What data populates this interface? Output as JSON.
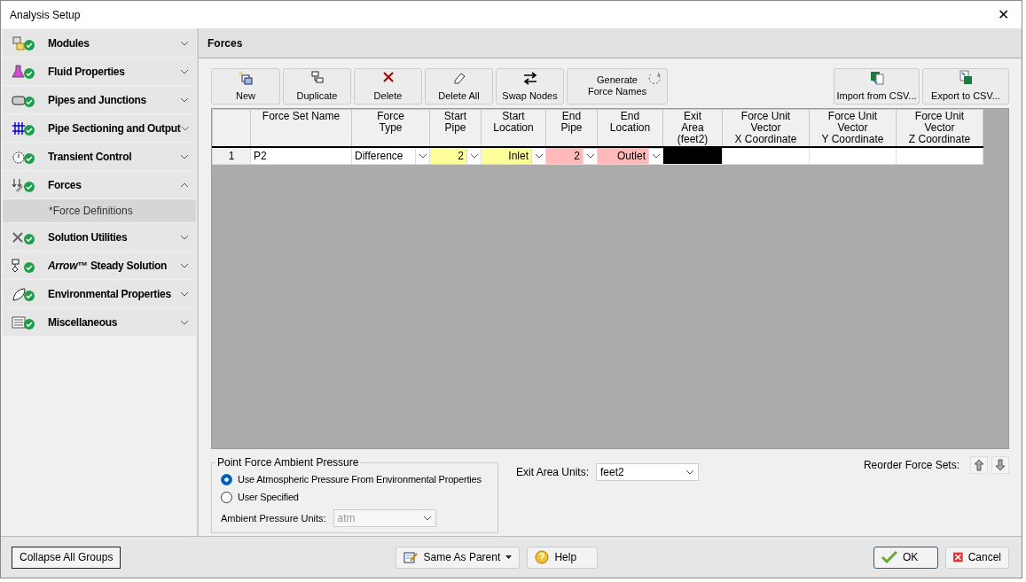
{
  "window": {
    "title": "Analysis Setup",
    "close": "✕"
  },
  "sidebar": {
    "items": [
      {
        "label": "Modules",
        "expanded": false
      },
      {
        "label": "Fluid Properties",
        "expanded": false
      },
      {
        "label": "Pipes and Junctions",
        "expanded": false
      },
      {
        "label": "Pipe Sectioning and Output",
        "expanded": false
      },
      {
        "label": "Transient Control",
        "expanded": false
      },
      {
        "label": "Forces",
        "expanded": true,
        "children": [
          {
            "label": "*Force Definitions",
            "selected": true
          }
        ]
      },
      {
        "label": "Solution Utilities",
        "expanded": false
      },
      {
        "label": "*Arrow*™ Steady Solution",
        "expanded": false
      },
      {
        "label": "Environmental Properties",
        "expanded": false
      },
      {
        "label": "Miscellaneous",
        "expanded": false
      }
    ]
  },
  "panel": {
    "title": "Forces"
  },
  "toolbar": [
    {
      "label": "New"
    },
    {
      "label": "Duplicate"
    },
    {
      "label": "Delete"
    },
    {
      "label": "Delete All"
    },
    {
      "label": "Swap Nodes"
    },
    {
      "label": "Generate\nForce Names"
    }
  ],
  "toolbar_right": [
    {
      "label": "Import from CSV..."
    },
    {
      "label": "Export to CSV..."
    }
  ],
  "table": {
    "columns": [
      "Force Set Name",
      "Force\nType",
      "Start\nPipe",
      "Start\nLocation",
      "End\nPipe",
      "End\nLocation",
      "Exit\nArea\n(feet2)",
      "Force Unit\nVector\nX Coordinate",
      "Force Unit\nVector\nY Coordinate",
      "Force Unit\nVector\nZ Coordinate"
    ],
    "rows": [
      {
        "number": "1",
        "cells": [
          {
            "text": "P2",
            "color": "#ffffff",
            "dropdown": false
          },
          {
            "text": "Difference",
            "color": "#ffffff",
            "dropdown": true
          },
          {
            "text": "2",
            "color": "#ffff99",
            "dropdown": true
          },
          {
            "text": "Inlet",
            "color": "#ffff99",
            "dropdown": true
          },
          {
            "text": "2",
            "color": "#ffb9b9",
            "dropdown": true
          },
          {
            "text": "Outlet",
            "color": "#ffb9b9",
            "dropdown": true
          },
          {
            "text": "",
            "color": "#000000",
            "dropdown": false
          },
          {
            "text": "",
            "color": "#ffffff",
            "dropdown": false
          },
          {
            "text": "",
            "color": "#ffffff",
            "dropdown": false
          },
          {
            "text": "",
            "color": "#ffffff",
            "dropdown": false
          }
        ]
      }
    ]
  },
  "ambient": {
    "title": "Point Force Ambient Pressure",
    "options": [
      {
        "label": "Use Atmospheric Pressure From Environmental Properties",
        "selected": true
      },
      {
        "label": "User Specified",
        "selected": false
      }
    ],
    "units_label": "Ambient Pressure Units:",
    "units_value": "atm",
    "units_disabled": true
  },
  "exit_area": {
    "label": "Exit Area Units:",
    "value": "feet2"
  },
  "reorder": {
    "label": "Reorder Force Sets:"
  },
  "footer": {
    "collapse": "Collapse All Groups",
    "parent": "Same As Parent",
    "help": "Help",
    "ok": "OK",
    "cancel": "Cancel"
  }
}
